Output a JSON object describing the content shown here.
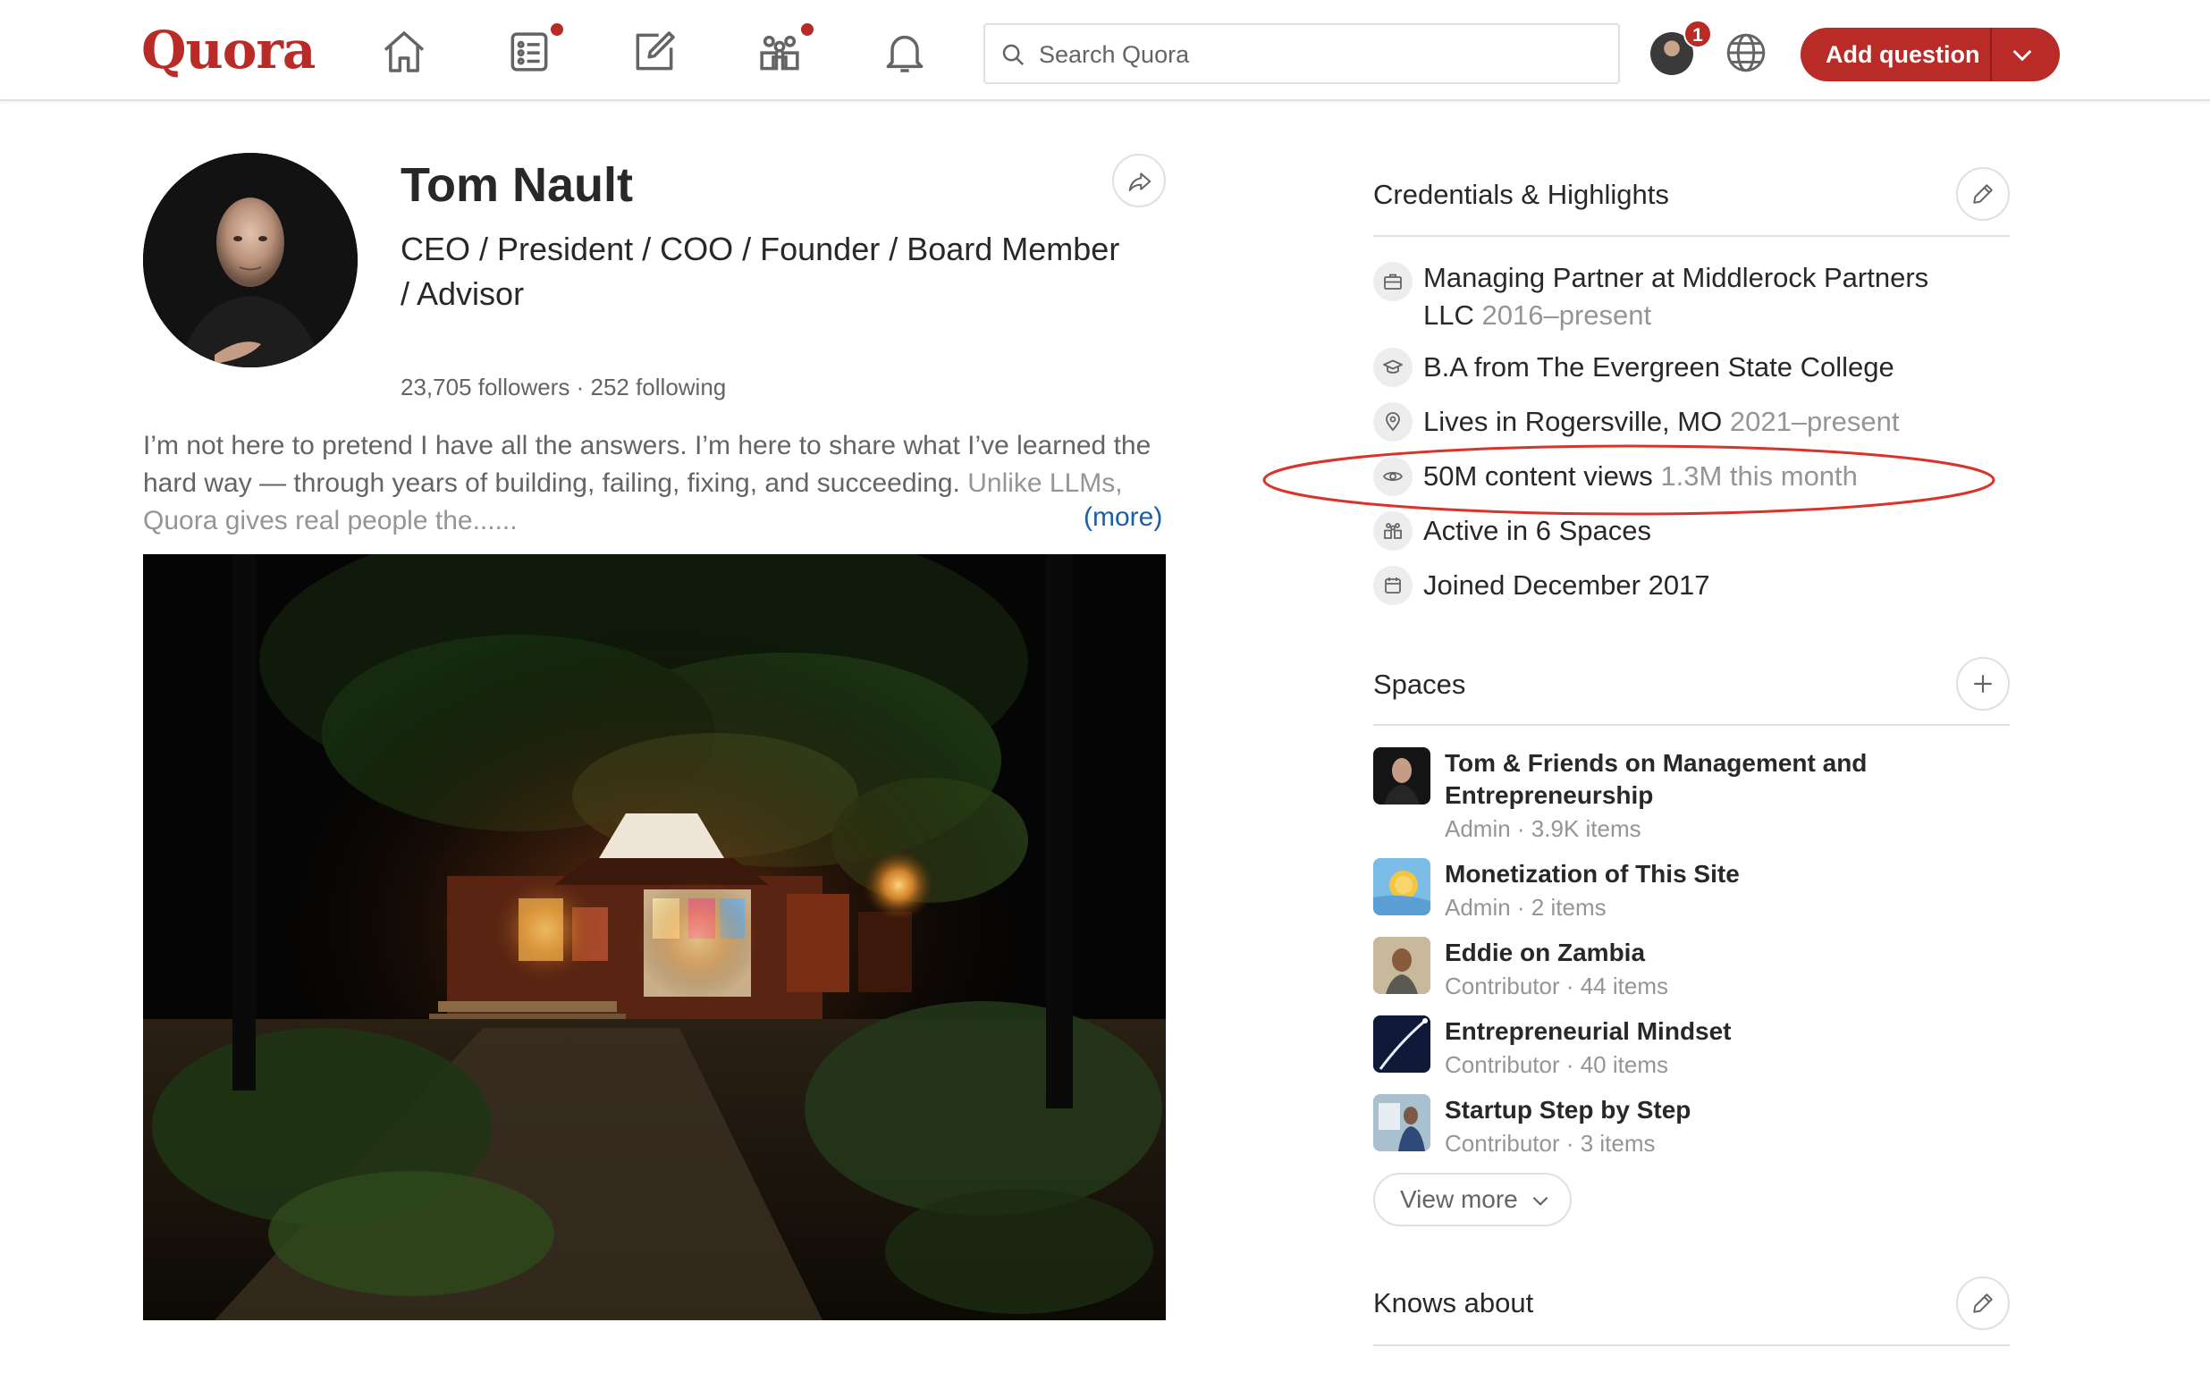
{
  "header": {
    "logo": "Quora",
    "search_placeholder": "Search Quora",
    "notification_count": "1",
    "add_question_label": "Add question"
  },
  "profile": {
    "name": "Tom Nault",
    "headline": "CEO / President / COO / Founder / Board Member / Advisor",
    "followers": "23,705 followers",
    "separator": "·",
    "following": "252 following",
    "bio_main": "I’m not here to pretend I have all the answers. I’m here to share what I’ve learned the hard way — through years of building, failing, fixing, and succeeding. ",
    "bio_faded": "Unlike LLMs, Quora gives real people the......",
    "more_label": "(more)"
  },
  "credentials": {
    "title": "Credentials & Highlights",
    "items": [
      {
        "icon": "briefcase-icon",
        "text": "Managing Partner at Middlerock Partners LLC",
        "muted": "2016–present"
      },
      {
        "icon": "graduation-cap-icon",
        "text": "B.A from The Evergreen State College",
        "muted": ""
      },
      {
        "icon": "location-pin-icon",
        "text": "Lives in Rogersville, MO",
        "muted": "2021–present"
      },
      {
        "icon": "eye-icon",
        "text": "50M content views",
        "muted": "1.3M this month"
      },
      {
        "icon": "spaces-icon",
        "text": "Active in 6 Spaces",
        "muted": ""
      },
      {
        "icon": "calendar-icon",
        "text": "Joined December 2017",
        "muted": ""
      }
    ]
  },
  "spaces": {
    "title": "Spaces",
    "items": [
      {
        "name": "Tom & Friends on Management and Entrepreneurship",
        "meta": "Admin · 3.9K items"
      },
      {
        "name": "Monetization of This Site",
        "meta": "Admin · 2 items"
      },
      {
        "name": "Eddie on Zambia",
        "meta": "Contributor · 44 items"
      },
      {
        "name": "Entrepreneurial Mindset",
        "meta": "Contributor · 40 items"
      },
      {
        "name": "Startup Step by Step",
        "meta": "Contributor · 3 items"
      }
    ],
    "view_more_label": "View more"
  },
  "knows_about": {
    "title": "Knows about"
  },
  "colors": {
    "brand": "#b92b27",
    "link": "#195faa",
    "annotation": "#d9342b"
  }
}
